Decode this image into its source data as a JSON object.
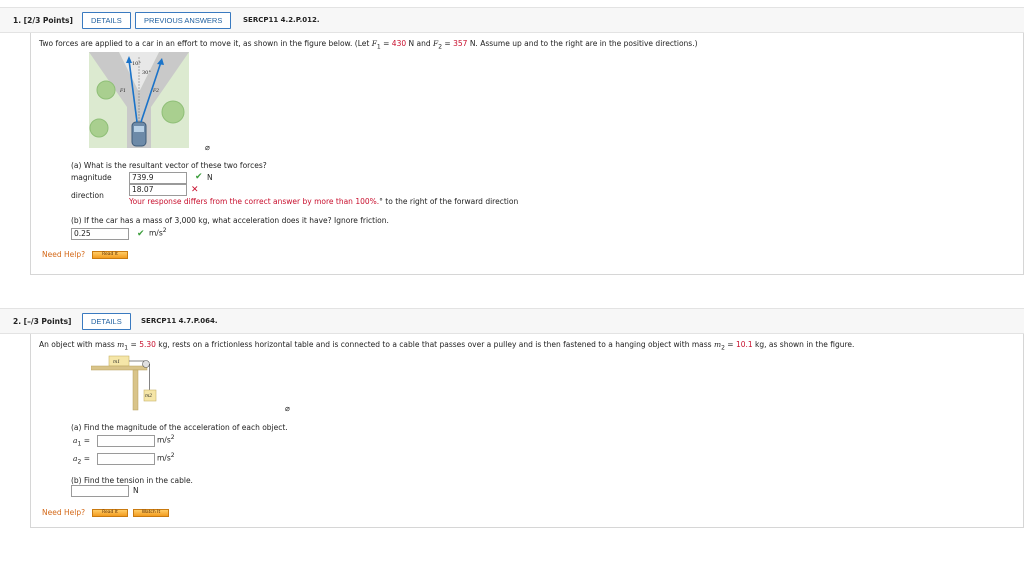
{
  "q1": {
    "number": "1. [2/3 Points]",
    "details": "DETAILS",
    "previous": "PREVIOUS ANSWERS",
    "code": "SERCP11 4.2.P.012.",
    "prompt_a": "Two forces are applied to a car in an effort to move it, as shown in the figure below. (Let ",
    "f1_sym": "F",
    "f1_sub": "1",
    "f1_eq": " = ",
    "f1_val": "430",
    "f1_unit": " N and ",
    "f2_sym": "F",
    "f2_sub": "2",
    "f2_eq": " = ",
    "f2_val": "357",
    "prompt_b": " N. Assume up and to the right are in the positive directions.)",
    "figure": {
      "angle1": "10°",
      "angle2": "30°",
      "label1": "F1",
      "label2": "F2"
    },
    "part_a": "(a) What is the resultant vector of these two forces?",
    "magnitude_label": "magnitude",
    "magnitude_value": "739.9",
    "magnitude_unit": "N",
    "direction_label": "direction",
    "direction_value": "18.07",
    "error_msg": "Your response differs from the correct answer by more than 100%.",
    "direction_suffix": "° to the right of the forward direction",
    "part_b": "(b) If the car has a mass of 3,000 kg, what acceleration does it have? Ignore friction.",
    "accel_value": "0.25",
    "accel_unit": "m/s",
    "accel_exp": "2",
    "need_help": "Need Help?",
    "read_it": "Read It"
  },
  "q2": {
    "number": "2. [–/3 Points]",
    "details": "DETAILS",
    "code": "SERCP11 4.7.P.064.",
    "prompt_a": "An object with mass ",
    "m1_sym": "m",
    "m1_sub": "1",
    "m1_eq": " = ",
    "m1_val": "5.30",
    "prompt_b": " kg, rests on a frictionless horizontal table and is connected to a cable that passes over a pulley and is then fastened to a hanging object with mass ",
    "m2_sym": "m",
    "m2_sub": "2",
    "m2_eq": " = ",
    "m2_val": "10.1",
    "prompt_c": " kg, as shown in the figure.",
    "figure": {
      "block1": "m1",
      "block2": "m2"
    },
    "part_a": "(a) Find the magnitude of the acceleration of each object.",
    "a1_label": "a",
    "a1_sub": "1",
    "a2_label": "a",
    "a2_sub": "2",
    "eq": " =",
    "a_unit": "m/s",
    "a_exp": "2",
    "part_b": "(b) Find the tension in the cable.",
    "tension_unit": "N",
    "need_help": "Need Help?",
    "read_it": "Read It",
    "watch_it": "Watch It"
  },
  "colors": {
    "accent": "#1f5f9f",
    "error": "#c8102e",
    "correct": "#3a9d3a",
    "help": "#d46a1a"
  }
}
